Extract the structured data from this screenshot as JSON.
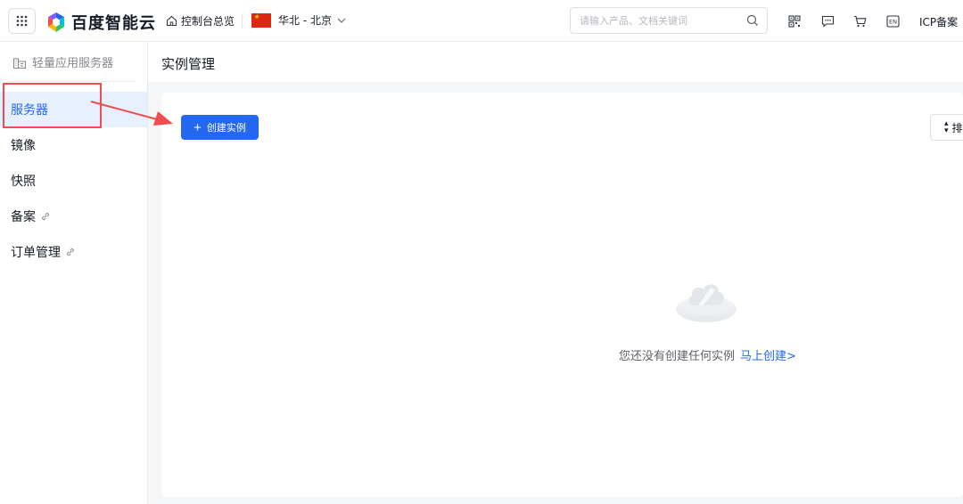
{
  "header": {
    "logo_text": "百度智能云",
    "home_label": "控制台总览",
    "region_label": "华北 - 北京",
    "search_placeholder": "请输入产品、文档关键词",
    "icp_label": "ICP备案",
    "en_label": "EN"
  },
  "sidebar": {
    "product_title": "轻量应用服务器",
    "items": [
      {
        "label": "服务器",
        "active": true,
        "external": false
      },
      {
        "label": "镜像",
        "active": false,
        "external": false
      },
      {
        "label": "快照",
        "active": false,
        "external": false
      },
      {
        "label": "备案",
        "active": false,
        "external": true
      },
      {
        "label": "订单管理",
        "active": false,
        "external": true
      }
    ]
  },
  "main": {
    "page_title": "实例管理",
    "create_button_label": "创建实例",
    "sort_button_label": "排",
    "empty_text": "您还没有创建任何实例",
    "empty_link": "马上创建>"
  },
  "annotation": {
    "box_color": "#f04e4e",
    "arrow_color": "#f04e4e"
  },
  "theme": {
    "accent": "#2468f2",
    "active_bg": "#e6f0ff"
  }
}
